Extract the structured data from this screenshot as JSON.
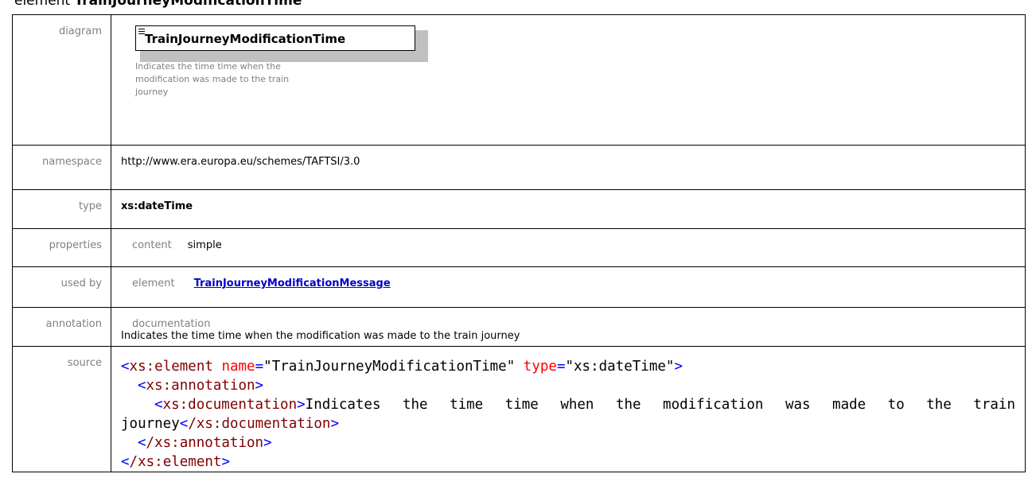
{
  "heading": {
    "prefix": "element",
    "name": "TrainJourneyModificationTime"
  },
  "rows": {
    "diagram": {
      "label": "diagram",
      "box_title": "TrainJourneyModificationTime",
      "description": "Indicates the time time when the modification was made to the train journey"
    },
    "namespace": {
      "label": "namespace",
      "value": "http://www.era.europa.eu/schemes/TAFTSI/3.0"
    },
    "type": {
      "label": "type",
      "value": "xs:dateTime"
    },
    "properties": {
      "label": "properties",
      "key": "content",
      "value": "simple"
    },
    "used_by": {
      "label": "used by",
      "key": "element",
      "link": "TrainJourneyModificationMessage"
    },
    "annotation": {
      "label": "annotation",
      "key": "documentation",
      "value": "Indicates the time time when the modification was made to the train journey"
    },
    "source": {
      "label": "source",
      "open_el": "xs:element",
      "attr_name": "name",
      "attr_name_val": "\"TrainJourneyModificationTime\"",
      "attr_type": "type",
      "attr_type_val": "\"xs:dateTime\"",
      "annotation_el": "xs:annotation",
      "documentation_el": "xs:documentation",
      "doc_text": "Indicates the time time when the modification was made to the train journey",
      "close_documentation_el": "/xs:documentation",
      "close_annotation_el": "/xs:annotation",
      "close_el": "/xs:element"
    }
  },
  "colors": {
    "label": "#808080",
    "link": "#0000cc",
    "xml_tag": "#800000",
    "xml_attr": "#ff0000",
    "xml_punct": "#0000ff"
  },
  "icons": [
    "element-lines-icon"
  ]
}
